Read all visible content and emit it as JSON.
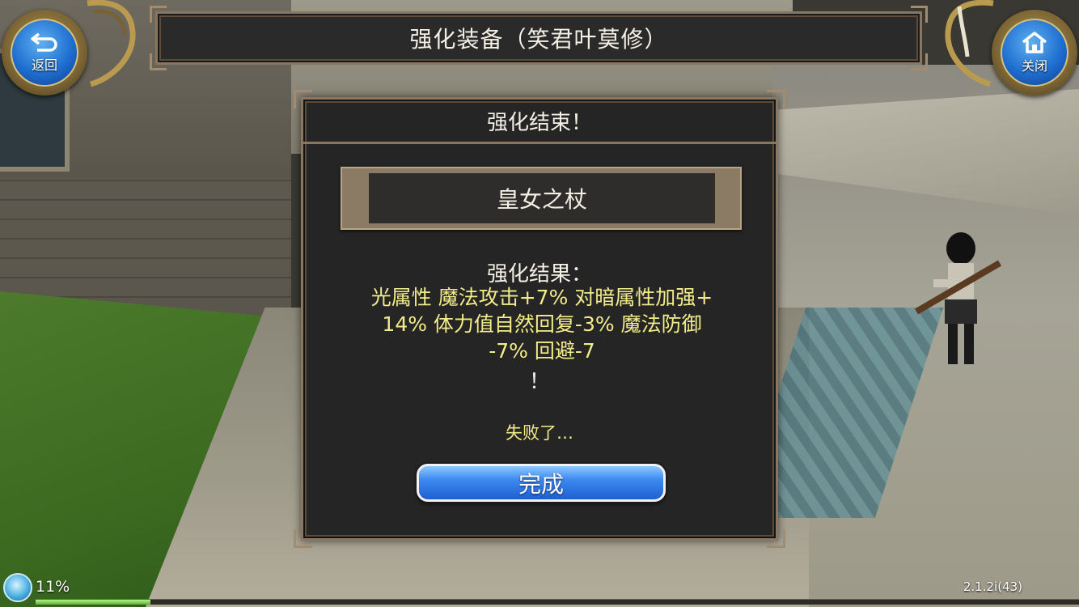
{
  "header": {
    "title": "强化装备（笑君叶莫修）",
    "back_label": "返回",
    "close_label": "关闭"
  },
  "dialog": {
    "title": "强化结束！",
    "item_name": "皇女之杖",
    "result_label": "强化结果：",
    "result_lines": [
      "光属性 魔法攻击+7% 对暗属性加强+",
      "14% 体力值自然回复-3% 魔法防御",
      "-7% 回避-7"
    ],
    "result_suffix": "！",
    "outcome": "失败了…",
    "done_label": "完成"
  },
  "status": {
    "percent_label": "11%",
    "progress": 0.11,
    "version": "2.1.2i(43)"
  },
  "colors": {
    "panel_bg": "#252525",
    "frame": "#8a7761",
    "result_text": "#f3ec8a",
    "button_blue": "#3d8af0"
  },
  "icons": {
    "back": "back-arrow-icon",
    "close": "home-icon",
    "status": "spirit-orb-icon"
  }
}
